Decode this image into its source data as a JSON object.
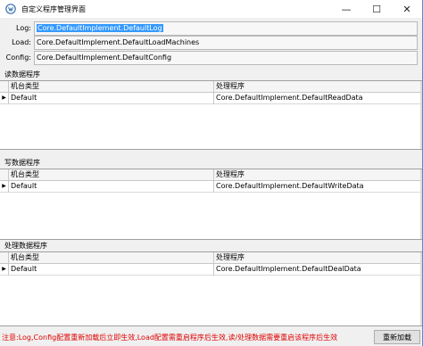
{
  "window": {
    "title": "自定义程序管理界面",
    "icon": "app-logo-icon",
    "minimize_glyph": "—",
    "maximize_glyph": "☐",
    "close_glyph": "✕"
  },
  "config": {
    "log_label": "Log:",
    "log_value": "Core.DefaultImplement.DefaultLog",
    "load_label": "Load:",
    "load_value": "Core.DefaultImplement.DefaultLoadMachines",
    "config_label": "Config:",
    "config_value": "Core.DefaultImplement.DefaultConfig"
  },
  "groups": {
    "read": {
      "title": "读数据程序",
      "columns": [
        "机台类型",
        "处理程序"
      ],
      "row_marker": "▶",
      "rows": [
        [
          "Default",
          "Core.DefaultImplement.DefaultReadData"
        ]
      ]
    },
    "write": {
      "title": "写数据程序",
      "columns": [
        "机台类型",
        "处理程序"
      ],
      "row_marker": "▶",
      "rows": [
        [
          "Default",
          "Core.DefaultImplement.DefaultWriteData"
        ]
      ]
    },
    "deal": {
      "title": "处理数据程序",
      "columns": [
        "机台类型",
        "处理程序"
      ],
      "row_marker": "▶",
      "rows": [
        [
          "Default",
          "Core.DefaultImplement.DefaultDealData"
        ]
      ]
    }
  },
  "footer": {
    "notice": "注意:Log,Config配置重新加载后立即生效,Load配置需重启程序后生效,读/处理数据需要重启该程序后生效",
    "notice_color": "#e00000",
    "reload_button": "重新加载"
  },
  "colors": {
    "selection": "#3399ff",
    "accent_border": "#4a90d9"
  }
}
